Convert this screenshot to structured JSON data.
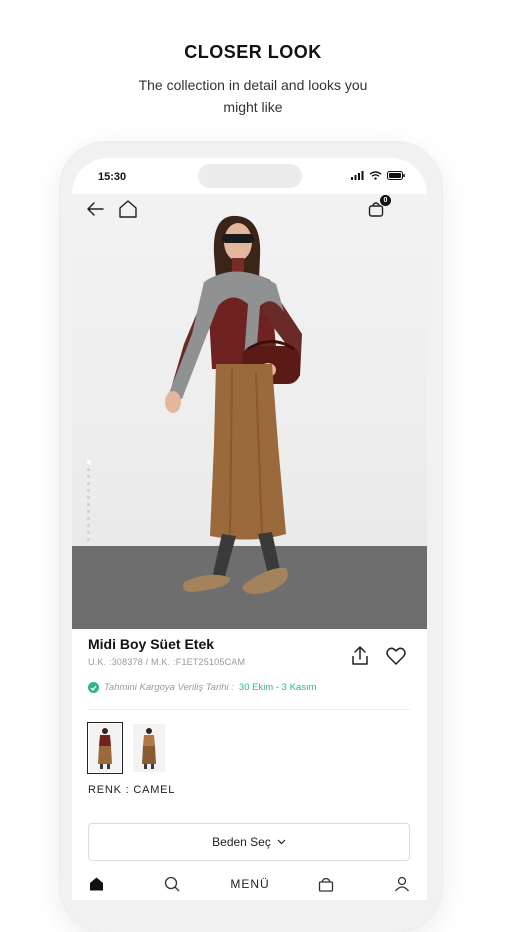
{
  "header": {
    "title": "CLOSER LOOK",
    "subtitle": "The collection in detail and looks you might like"
  },
  "status_bar": {
    "time": "15:30",
    "icons": [
      "signal-icon",
      "wifi-icon",
      "battery-icon"
    ]
  },
  "top_nav": {
    "back_icon": "arrow-left-icon",
    "home_icon": "home-icon",
    "cart_icon": "shopping-bag-icon",
    "cart_count": "0"
  },
  "product": {
    "name": "Midi Boy Süet Etek",
    "codes": "U.K. :308378 / M.K. :F1ET25105CAM",
    "delivery_label": "Tahmini Kargoya Veriliş Tarihi :",
    "delivery_dates": "30 Ekim - 3 Kasım",
    "color_label": "RENK : CAMEL",
    "size_button": "Beden Seç",
    "image_count": 12,
    "active_image_index": 0,
    "swatch_count": 2,
    "selected_swatch_index": 0
  },
  "tabbar": {
    "menu_label": "MENÜ",
    "icons": [
      "home-icon",
      "search-icon",
      "bag-icon",
      "profile-icon"
    ]
  },
  "colors": {
    "accent_green": "#2db48c",
    "text_dark": "#111111",
    "text_muted": "#9a9a9a"
  }
}
